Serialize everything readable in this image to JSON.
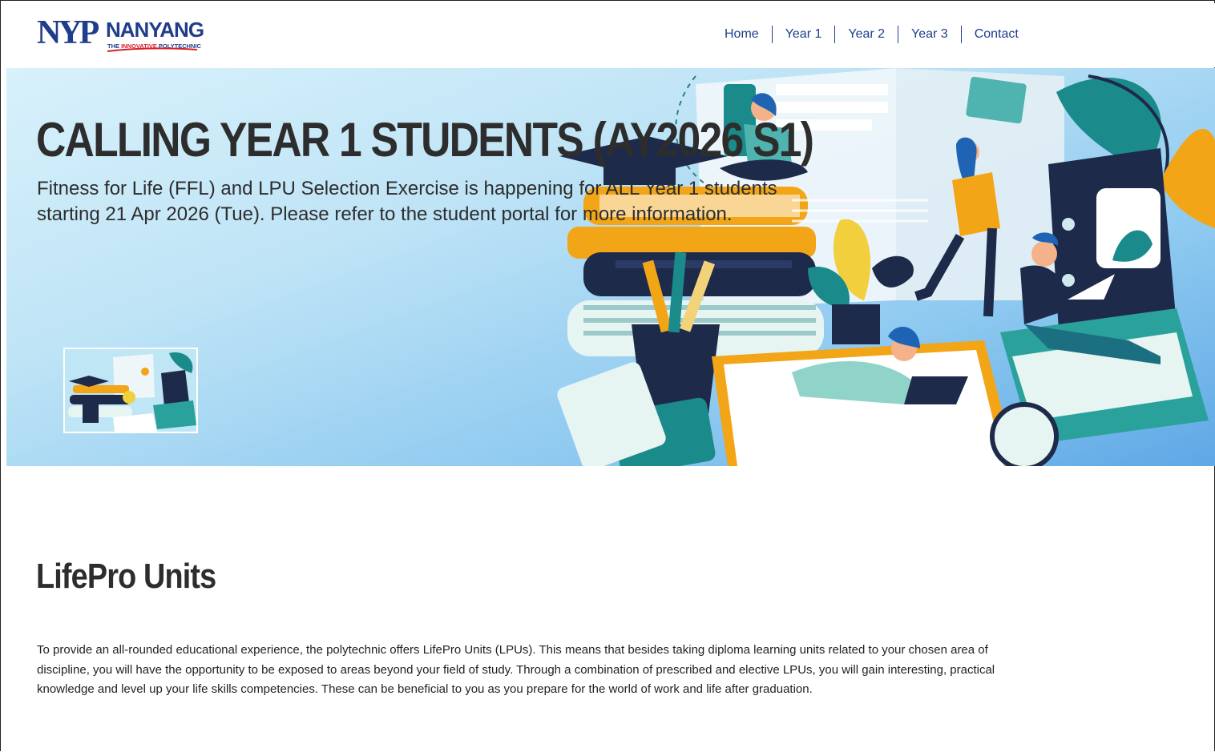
{
  "logo": {
    "mark": "NYP",
    "name": "NANYANG",
    "tagline_prefix": "THE ",
    "tagline_highlight": "INNOVATIVE",
    "tagline_suffix": " POLYTECHNIC"
  },
  "nav": {
    "items": [
      "Home",
      "Year 1",
      "Year 2",
      "Year 3",
      "Contact"
    ]
  },
  "hero": {
    "title": "CALLING YEAR 1 STUDENTS (AY2026 S1)",
    "subtitle": "Fitness for Life (FFL) and LPU Selection Exercise is happening for ALL Year 1 students starting 21 Apr 2026 (Tue). Please refer to the student portal for more information."
  },
  "section": {
    "title": "LifePro Units",
    "body": "To provide an all-rounded educational experience, the polytechnic offers LifePro Units (LPUs). This means that besides taking diploma learning units related to your chosen area of discipline, you will have the opportunity to be exposed to areas beyond your field of study. Through a combination of prescribed and elective LPUs, you will gain interesting, practical knowledge and level up your life skills competencies. These can be beneficial to you as you prepare for the world of work and life after graduation."
  },
  "colors": {
    "brand_blue": "#1f3d8a",
    "brand_red": "#d71f2b",
    "teal": "#1b8a8a",
    "navy": "#1e2a4a",
    "orange": "#f2a516"
  }
}
